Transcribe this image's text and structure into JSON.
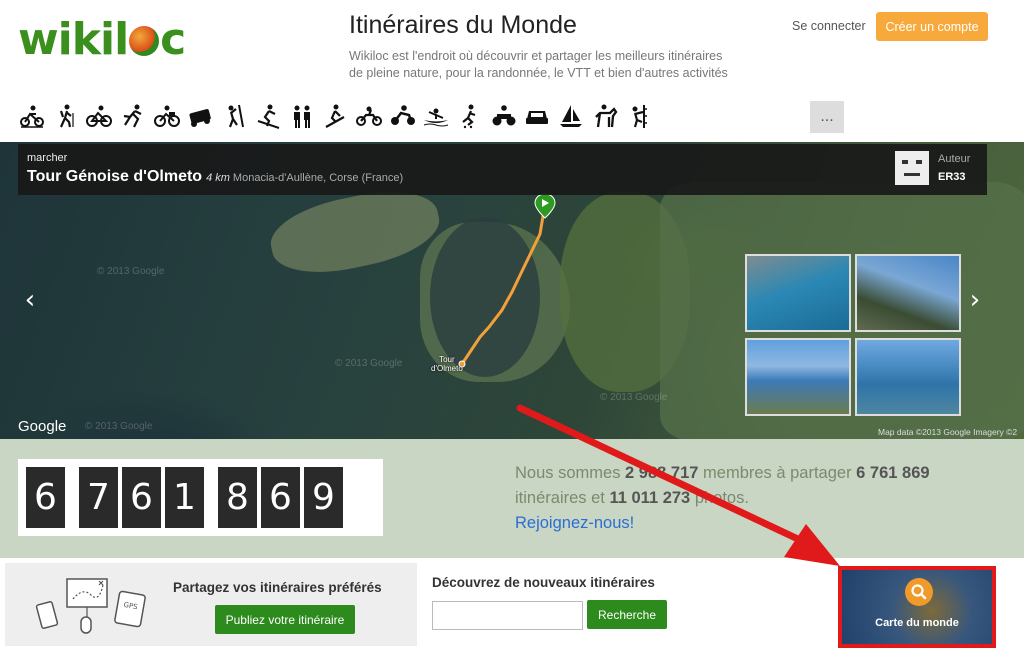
{
  "header": {
    "logo_text": "wikiloc",
    "site_title": "Itinéraires du Monde",
    "site_description": "Wikiloc est l'endroit où découvrir et partager les meilleurs itinéraires de pleine nature, pour la randonnée, le VTT et bien d'autres activités",
    "login_label": "Se connecter",
    "signup_label": "Créer un compte",
    "signup_color": "#f7a93b"
  },
  "activities": {
    "icons": [
      "mountain-bike-icon",
      "hiking-icon",
      "cycling-icon",
      "running-icon",
      "bicycle-touring-icon",
      "off-road-icon",
      "climbing-icon",
      "skiing-icon",
      "walking-icon",
      "ski-touring-icon",
      "motorcycle-icon",
      "enduro-icon",
      "kayak-icon",
      "skating-icon",
      "quad-icon",
      "car-icon",
      "sailing-icon",
      "horse-riding-icon",
      "via-ferrata-icon"
    ],
    "more_label": "..."
  },
  "route": {
    "category": "marcher",
    "name": "Tour Génoise d'Olmeto",
    "distance": "4 km",
    "location": "Monacia-d'Aullène, Corse (France)",
    "author_label": "Auteur",
    "author_name": "ER33"
  },
  "map": {
    "google_label": "Google",
    "watermark": "© 2013 Google",
    "map_data": "Map data ©2013 Google Imagery ©2",
    "place_label_line1": "Tour",
    "place_label_line2": "d'Olmeto",
    "prev_arrow": "‹",
    "next_arrow": "›",
    "route_color": "#f2a03a"
  },
  "stats": {
    "counter_digits": [
      "6",
      "7",
      "6",
      "1",
      "8",
      "6",
      "9"
    ],
    "text_prefix": "Nous sommes ",
    "members": "2 988 717",
    "text_mid": " membres à partager ",
    "routes": "6 761 869",
    "text_mid2": " itinéraires et ",
    "photos": "11 011 273",
    "text_suffix": " photos.",
    "join_label": "Rejoignez-nous!"
  },
  "bottom": {
    "share_title": "Partagez vos itinéraires préférés",
    "publish_label": "Publiez votre itinéraire",
    "discover_title": "Découvrez de nouveaux itinéraires",
    "search_placeholder": "",
    "search_label": "Recherche",
    "world_map_label": "Carte du monde",
    "gps_label": "GPS",
    "highlight_color": "#e01a1a",
    "button_color": "#2d8a1c"
  }
}
